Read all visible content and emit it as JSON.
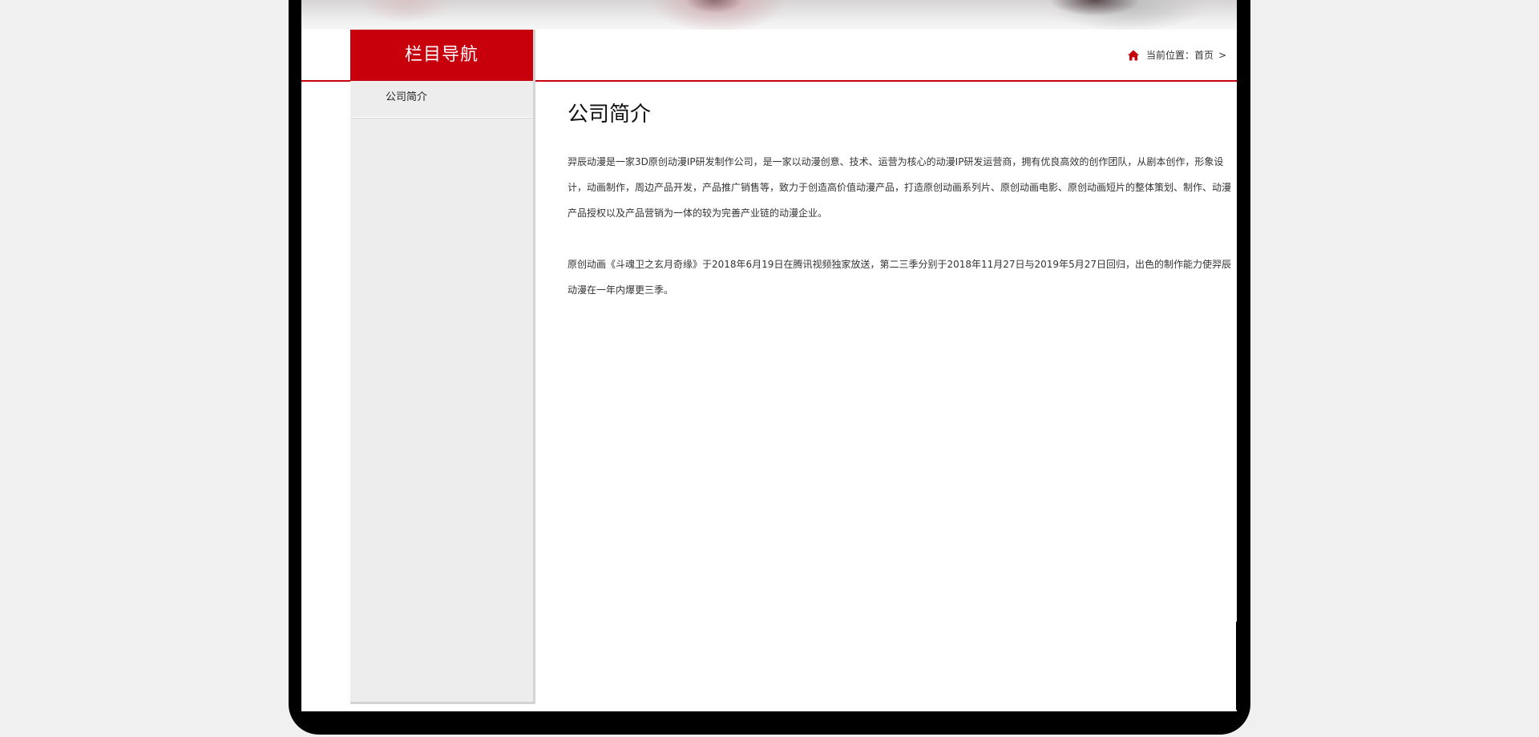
{
  "sidebar": {
    "title": "栏目导航",
    "items": [
      {
        "label": "公司简介"
      }
    ]
  },
  "breadcrumb": {
    "prefix": "当前位置：",
    "home": "首页",
    "separator": ">"
  },
  "article": {
    "title": "公司简介",
    "paragraphs": [
      "羿辰动漫是一家3D原创动漫IP研发制作公司，是一家以动漫创意、技术、运营为核心的动漫IP研发运营商，拥有优良高效的创作团队，从剧本创作，形象设计，动画制作，周边产品开发，产品推广销售等，致力于创造高价值动漫产品，打造原创动画系列片、原创动画电影、原创动画短片的整体策划、制作、动漫产品授权以及产品营销为一体的较为完善产业链的动漫企业。",
      "原创动画《斗魂卫之玄月奇缘》于2018年6月19日在腾讯视频独家放送，第二三季分别于2018年11月27日与2019年5月27日回归，出色的制作能力使羿辰动漫在一年内爆更三季。"
    ]
  },
  "colors": {
    "accent": "#c8000c",
    "frame": "#000000",
    "sidebar_bg": "#ededed"
  },
  "icons": {
    "home": "home-icon"
  }
}
